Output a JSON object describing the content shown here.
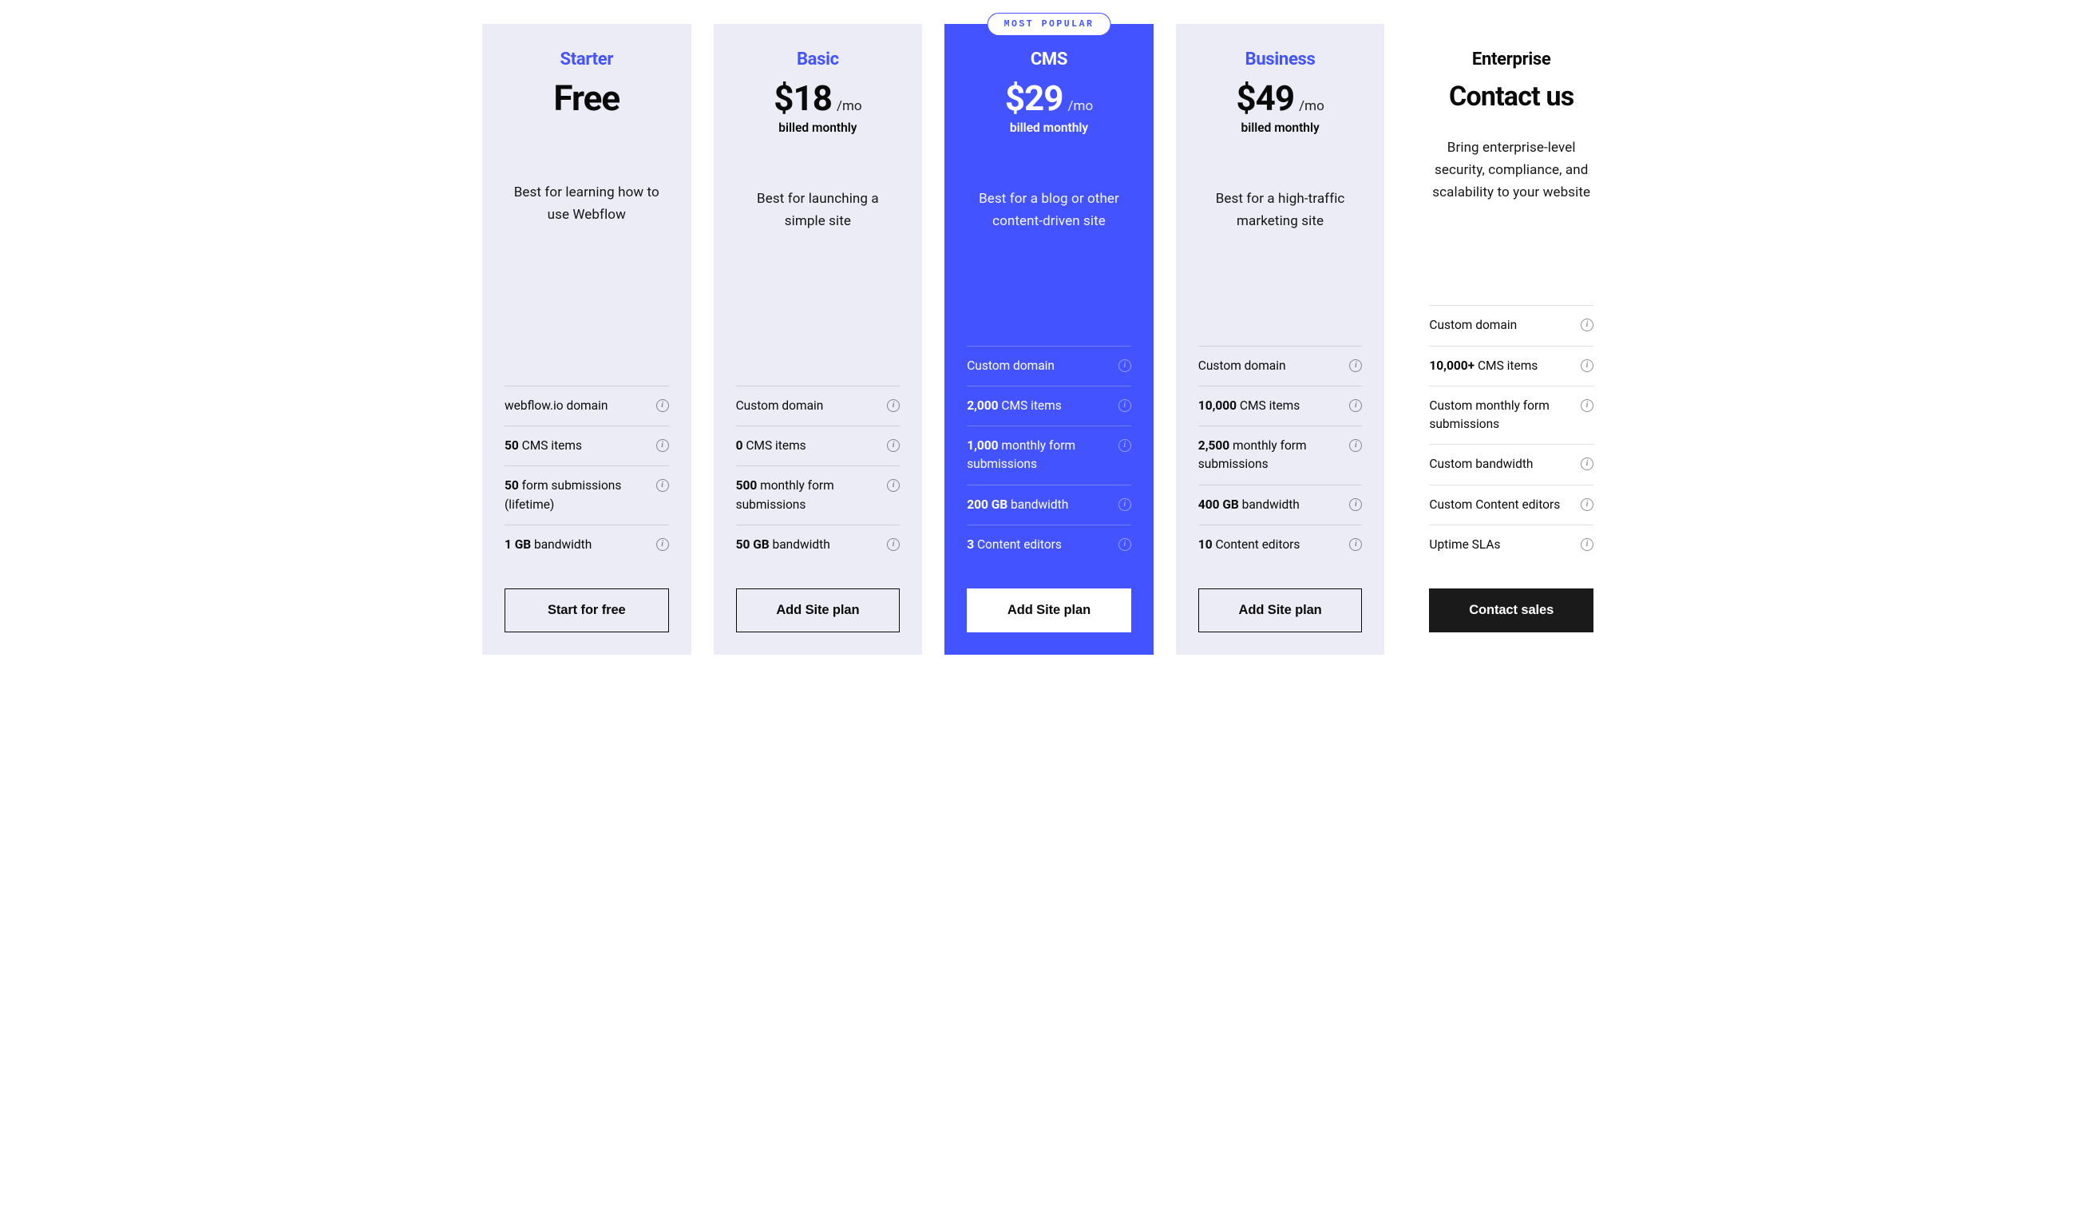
{
  "badge_text": "MOST POPULAR",
  "plans": [
    {
      "name": "Starter",
      "price": "Free",
      "price_suffix": "",
      "billing": "",
      "desc": "Best for learning how to use Webflow",
      "cta": "Start for free",
      "features": [
        {
          "bold": "",
          "rest": "webflow.io domain"
        },
        {
          "bold": "50",
          "rest": " CMS items"
        },
        {
          "bold": "50",
          "rest": " form submissions (lifetime)"
        },
        {
          "bold": "1 GB",
          "rest": " bandwidth"
        }
      ]
    },
    {
      "name": "Basic",
      "price": "$18",
      "price_suffix": "/mo",
      "billing": "billed monthly",
      "desc": "Best for launching a simple site",
      "cta": "Add Site plan",
      "features": [
        {
          "bold": "",
          "rest": "Custom domain"
        },
        {
          "bold": "0",
          "rest": " CMS items"
        },
        {
          "bold": "500",
          "rest": " monthly form submissions"
        },
        {
          "bold": "50 GB",
          "rest": " bandwidth"
        }
      ]
    },
    {
      "name": "CMS",
      "price": "$29",
      "price_suffix": "/mo",
      "billing": "billed monthly",
      "desc": "Best for a blog or other content-driven site",
      "cta": "Add Site plan",
      "features": [
        {
          "bold": "",
          "rest": "Custom domain"
        },
        {
          "bold": "2,000",
          "rest": " CMS items"
        },
        {
          "bold": "1,000",
          "rest": " monthly form submissions"
        },
        {
          "bold": "200 GB",
          "rest": " bandwidth"
        },
        {
          "bold": "3",
          "rest": " Content editors"
        }
      ]
    },
    {
      "name": "Business",
      "price": "$49",
      "price_suffix": "/mo",
      "billing": "billed monthly",
      "desc": "Best for a high-traffic marketing site",
      "cta": "Add Site plan",
      "features": [
        {
          "bold": "",
          "rest": "Custom domain"
        },
        {
          "bold": "10,000",
          "rest": " CMS items"
        },
        {
          "bold": "2,500",
          "rest": " monthly form submissions"
        },
        {
          "bold": "400 GB",
          "rest": " bandwidth"
        },
        {
          "bold": "10",
          "rest": " Content editors"
        }
      ]
    },
    {
      "name": "Enterprise",
      "price": "Contact us",
      "price_suffix": "",
      "billing": "",
      "desc": "Bring enterprise-level security, compliance, and scalability to your website",
      "cta": "Contact sales",
      "features": [
        {
          "bold": "",
          "rest": "Custom domain"
        },
        {
          "bold": "10,000+",
          "rest": " CMS items"
        },
        {
          "bold": "",
          "rest": "Custom monthly form submissions"
        },
        {
          "bold": "",
          "rest": "Custom bandwidth"
        },
        {
          "bold": "",
          "rest": "Custom Content editors"
        },
        {
          "bold": "",
          "rest": "Uptime SLAs"
        }
      ]
    }
  ]
}
